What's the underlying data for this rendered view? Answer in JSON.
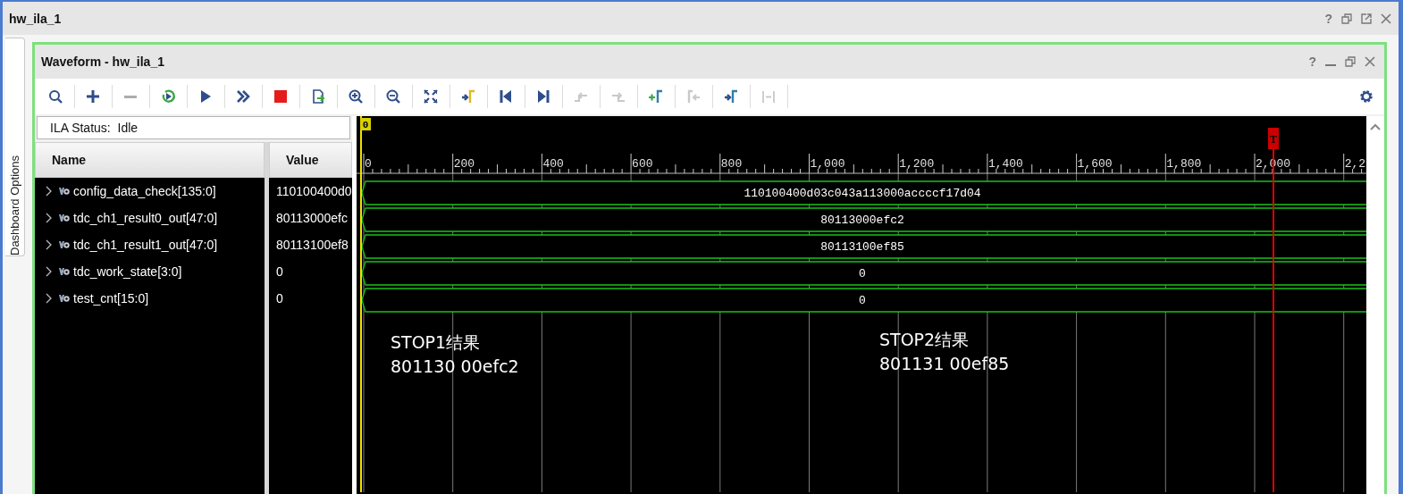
{
  "window": {
    "title": "hw_ila_1",
    "help": "?"
  },
  "side_tab": {
    "label": "Dashboard Options"
  },
  "panel": {
    "title": "Waveform - hw_ila_1",
    "help": "?"
  },
  "toolbar": [
    {
      "kind": "search",
      "disabled": false
    },
    {
      "kind": "add",
      "disabled": false
    },
    {
      "kind": "remove",
      "disabled": true
    },
    {
      "kind": "run-trigger",
      "disabled": false
    },
    {
      "kind": "run",
      "disabled": false
    },
    {
      "kind": "run-immediate",
      "disabled": false
    },
    {
      "kind": "stop",
      "disabled": false
    },
    {
      "kind": "export",
      "disabled": false
    },
    {
      "kind": "zoom-in",
      "disabled": false
    },
    {
      "kind": "zoom-out",
      "disabled": false
    },
    {
      "kind": "zoom-fit",
      "disabled": false
    },
    {
      "kind": "go-zero",
      "disabled": false
    },
    {
      "kind": "prev",
      "disabled": false
    },
    {
      "kind": "next",
      "disabled": false
    },
    {
      "kind": "prev-transition",
      "disabled": true
    },
    {
      "kind": "next-transition",
      "disabled": true
    },
    {
      "kind": "add-marker",
      "disabled": false
    },
    {
      "kind": "prev-marker",
      "disabled": true
    },
    {
      "kind": "next-marker",
      "disabled": false
    },
    {
      "kind": "swap-cursors",
      "disabled": true
    }
  ],
  "status": "ILA Status:  Idle",
  "columns": [
    "Name",
    "Value"
  ],
  "signals": [
    {
      "name": "config_data_check[135:0]",
      "value": "110100400d0",
      "wave_value": "110100400d03c043a113000accccf17d04",
      "expanded": false
    },
    {
      "name": "tdc_ch1_result0_out[47:0]",
      "value": "80113000efc",
      "wave_value": "80113000efc2",
      "expanded": false
    },
    {
      "name": "tdc_ch1_result1_out[47:0]",
      "value": "80113100ef8",
      "wave_value": "80113100ef85",
      "expanded": false
    },
    {
      "name": "tdc_work_state[3:0]",
      "value": "0",
      "wave_value": "0",
      "expanded": false
    },
    {
      "name": "test_cnt[15:0]",
      "value": "0",
      "wave_value": "0",
      "expanded": false
    }
  ],
  "ruler": {
    "origin": "0",
    "ticks": [
      "0",
      "200",
      "400",
      "600",
      "800",
      "1,000",
      "1,200",
      "1,400",
      "1,600",
      "1,800",
      "2,000",
      "2,2"
    ]
  },
  "trigger": {
    "label": "T"
  },
  "annotations": [
    {
      "text": "STOP1结果\n801130 00efc2"
    },
    {
      "text": "STOP2结果\n801131 00ef85"
    }
  ]
}
